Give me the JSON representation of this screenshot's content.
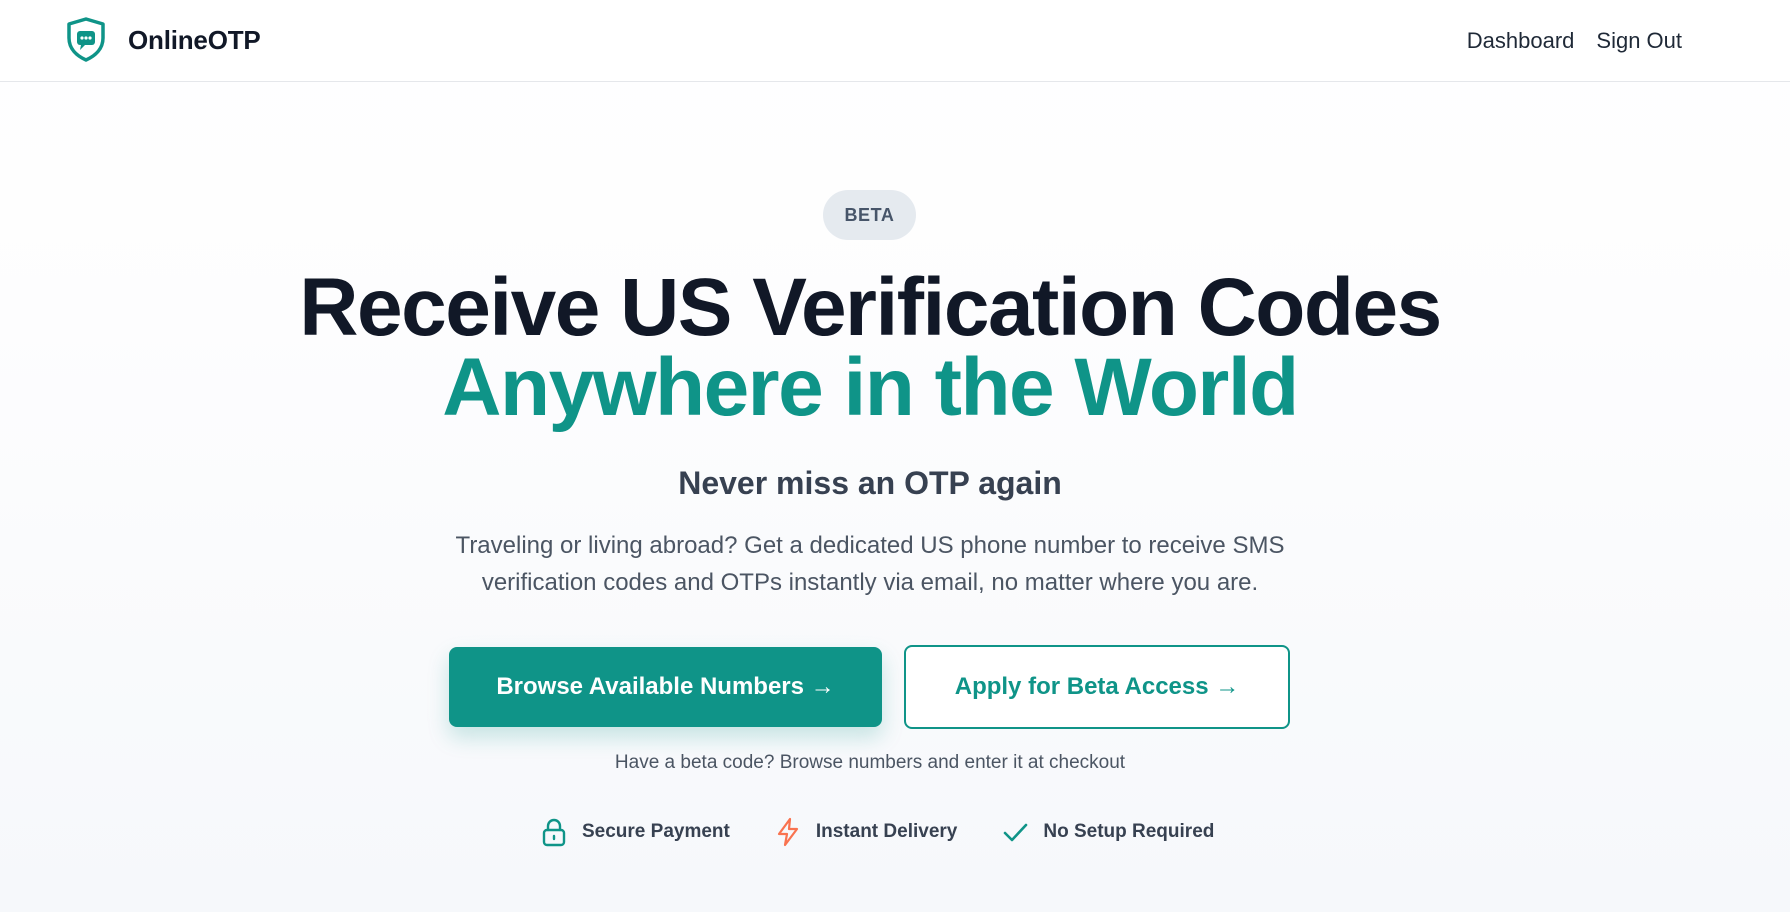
{
  "header": {
    "brand_name": "OnlineOTP",
    "brand_icon": "shield-chat-icon",
    "nav": [
      {
        "label": "Dashboard"
      },
      {
        "label": "Sign Out"
      }
    ]
  },
  "hero": {
    "badge": "BETA",
    "headline_line1": "Receive US Verification Codes",
    "headline_line2": "Anywhere in the World",
    "tagline": "Never miss an OTP again",
    "description_line1": "Traveling or living abroad? Get a dedicated US phone number to receive SMS",
    "description_line2": "verification codes and OTPs instantly via email, no matter where you are.",
    "primary_cta": "Browse Available Numbers →",
    "secondary_cta": "Apply for Beta Access →",
    "hint": "Have a beta code? Browse numbers and enter it at checkout"
  },
  "features": [
    {
      "label": "Secure Payment",
      "icon": "lock-icon"
    },
    {
      "label": "Instant Delivery",
      "icon": "lightning-icon"
    },
    {
      "label": "No Setup Required",
      "icon": "check-icon"
    }
  ],
  "colors": {
    "accent": "#0f9488",
    "heading": "#111827",
    "body_text": "#4b5563",
    "badge_bg": "#e5eaef",
    "lightning": "#f97350"
  }
}
